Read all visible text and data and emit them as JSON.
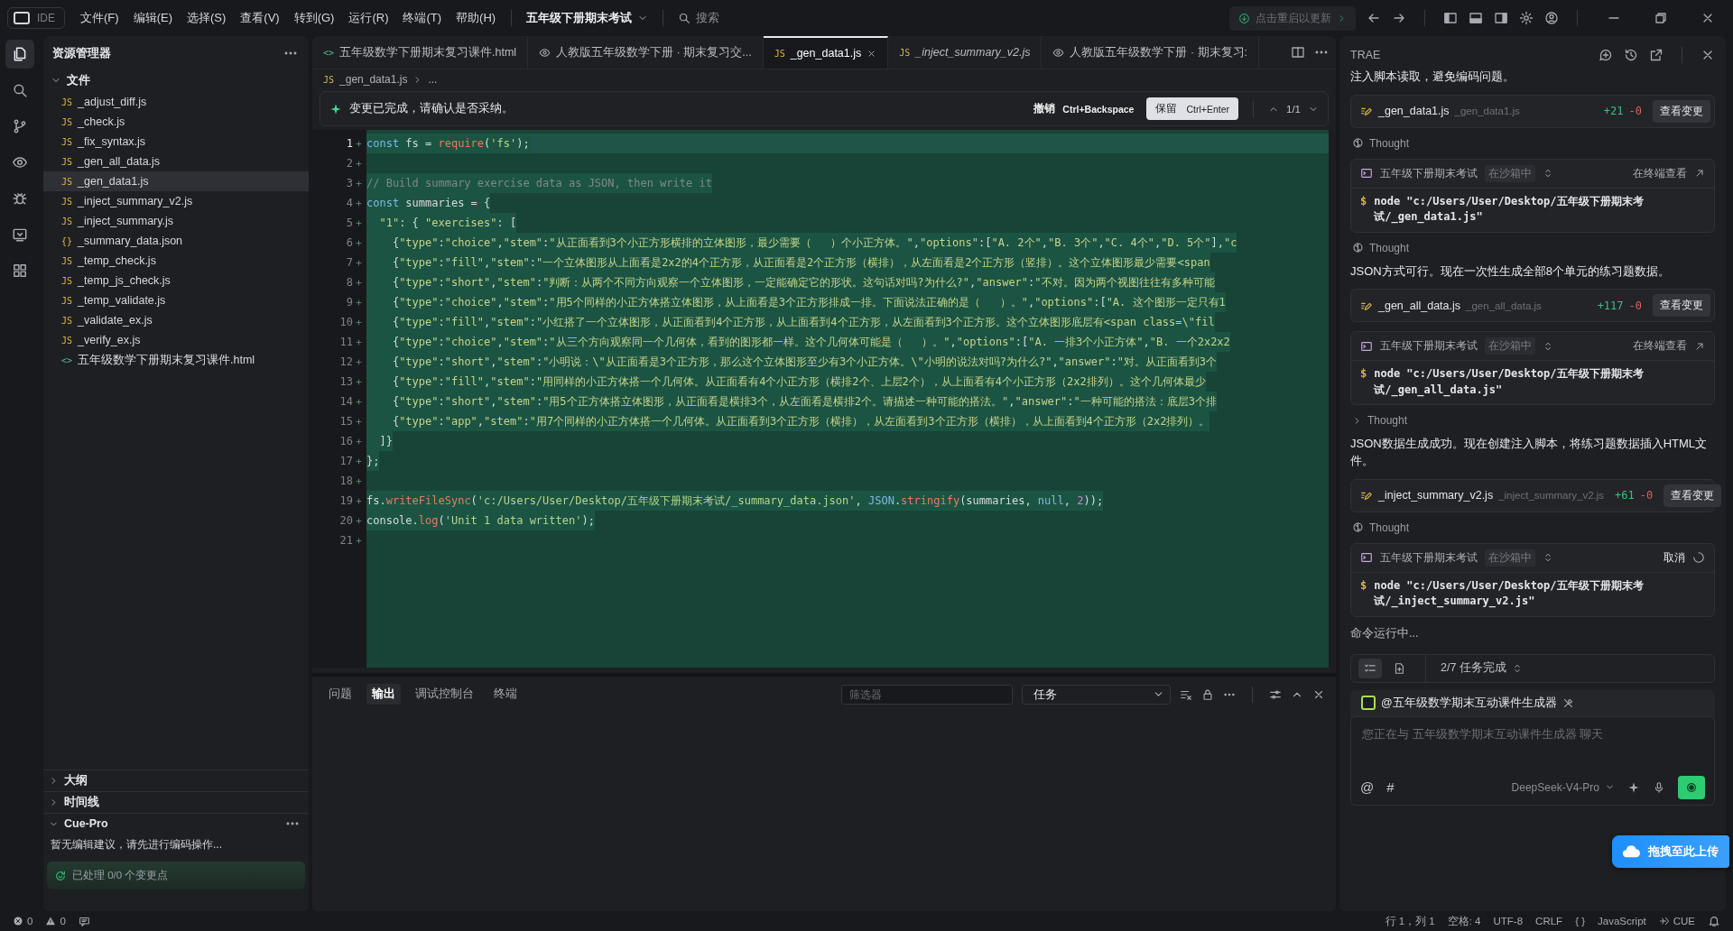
{
  "titlebar": {
    "logo": "IDE",
    "menus": [
      "文件(F)",
      "编辑(E)",
      "选择(S)",
      "查看(V)",
      "转到(G)",
      "运行(R)",
      "终端(T)",
      "帮助(H)"
    ],
    "project": "五年级下册期末考试",
    "search_placeholder": "搜索",
    "update": "点击重启以更新"
  },
  "activity": [
    {
      "kind": "files",
      "selected": true
    },
    {
      "kind": "search",
      "selected": false
    },
    {
      "kind": "branch",
      "selected": false
    },
    {
      "kind": "eye",
      "selected": false
    },
    {
      "kind": "bug",
      "selected": false
    },
    {
      "kind": "remote",
      "selected": false
    },
    {
      "kind": "grid",
      "selected": false
    }
  ],
  "explorer": {
    "title": "资源管理器",
    "folder": "文件",
    "files": [
      {
        "badge": "JS",
        "name": "_adjust_diff.js",
        "selected": false
      },
      {
        "badge": "JS",
        "name": "_check.js",
        "selected": false
      },
      {
        "badge": "JS",
        "name": "_fix_syntax.js",
        "selected": false
      },
      {
        "badge": "JS",
        "name": "_gen_all_data.js",
        "selected": false
      },
      {
        "badge": "JS",
        "name": "_gen_data1.js",
        "selected": true
      },
      {
        "badge": "JS",
        "name": "_inject_summary_v2.js",
        "selected": false
      },
      {
        "badge": "JS",
        "name": "_inject_summary.js",
        "selected": false
      },
      {
        "badge": "{}",
        "name": "_summary_data.json",
        "selected": false
      },
      {
        "badge": "JS",
        "name": "_temp_check.js",
        "selected": false
      },
      {
        "badge": "JS",
        "name": "_temp_js_check.js",
        "selected": false
      },
      {
        "badge": "JS",
        "name": "_temp_validate.js",
        "selected": false
      },
      {
        "badge": "JS",
        "name": "_validate_ex.js",
        "selected": false
      },
      {
        "badge": "JS",
        "name": "_verify_ex.js",
        "selected": false
      },
      {
        "badge": "<>",
        "name": "五年级数学下册期末复习课件.html",
        "selected": false
      }
    ],
    "sections": [
      {
        "title": "大纲",
        "expanded": false
      },
      {
        "title": "时间线",
        "expanded": false
      },
      {
        "title": "Cue-Pro",
        "expanded": true,
        "message": "暂无编辑建议，请先进行编码操作...",
        "status": "已处理 0/0 个变更点"
      }
    ]
  },
  "tabs": [
    {
      "kind": "html",
      "badge": "<>",
      "label": "五年级数学下册期末复习课件.html",
      "selected": false
    },
    {
      "kind": "preview",
      "label": "人教版五年级数学下册 · 期末复习交...",
      "selected": false
    },
    {
      "kind": "js",
      "badge": "JS",
      "label": "_gen_data1.js",
      "selected": true
    },
    {
      "kind": "js",
      "badge": "JS",
      "label": "_inject_summary_v2.js",
      "selected": false
    },
    {
      "kind": "preview",
      "label": "人教版五年级数学下册 · 期末复习:",
      "selected": false
    }
  ],
  "breadcrumb": {
    "badge": "JS",
    "file": "_gen_data1.js",
    "rest": "..."
  },
  "review_bar": {
    "message": "变更已完成，请确认是否采纳。",
    "undo": "撤销",
    "undo_key": "Ctrl+Backspace",
    "keep": "保留",
    "keep_key": "Ctrl+Enter",
    "count": "1/1"
  },
  "code": [
    {
      "num": "1",
      "added": true,
      "text": "const fs = require('fs');"
    },
    {
      "num": "2",
      "added": true
    },
    {
      "num": "3",
      "added": true,
      "text": "// Build summary exercise data as JSON, then write it"
    },
    {
      "num": "4",
      "added": true,
      "text": "const summaries = {"
    },
    {
      "num": "5",
      "added": true,
      "text": "  \"1\": { \"exercises\": ["
    },
    {
      "num": "6",
      "added": true,
      "text": "    {\"type\":\"choice\",\"stem\":\"从正面看到3个小正方形横排的立体图形，最少需要（   ）个小正方体。\",\"options\":[\"A. 2个\",\"B. 3个\",\"C. 4个\",\"D. 5个\"],\"c"
    },
    {
      "num": "7",
      "added": true,
      "text": "    {\"type\":\"fill\",\"stem\":\"一个立体图形从上面看是2x2的4个正方形，从正面看是2个正方形（横排），从左面看是2个正方形（竖排）。这个立体图形最少需要<span"
    },
    {
      "num": "8",
      "added": true,
      "text": "    {\"type\":\"short\",\"stem\":\"判断：从两个不同方向观察一个立体图形，一定能确定它的形状。这句话对吗?为什么?\",\"answer\":\"不对。因为两个视图往往有多种可能"
    },
    {
      "num": "9",
      "added": true,
      "text": "    {\"type\":\"choice\",\"stem\":\"用5个同样的小正方体搭立体图形，从上面看是3个正方形排成一排。下面说法正确的是（   ）。\",\"options\":[\"A. 这个图形一定只有1"
    },
    {
      "num": "10",
      "added": true,
      "text": "    {\"type\":\"fill\",\"stem\":\"小红搭了一个立体图形，从正面看到4个正方形，从上面看到4个正方形，从左面看到3个正方形。这个立体图形底层有<span class=\\\"fil"
    },
    {
      "num": "11",
      "added": true,
      "text": "    {\"type\":\"choice\",\"stem\":\"从三个方向观察同一个几何体，看到的图形都一样。这个几何体可能是（   ）。\",\"options\":[\"A. 一排3个小正方体\",\"B. 一个2x2x2"
    },
    {
      "num": "12",
      "added": true,
      "text": "    {\"type\":\"short\",\"stem\":\"小明说：\\\"从正面看是3个正方形，那么这个立体图形至少有3个小正方体。\\\"小明的说法对吗?为什么?\",\"answer\":\"对。从正面看到3个"
    },
    {
      "num": "13",
      "added": true,
      "text": "    {\"type\":\"fill\",\"stem\":\"用同样的小正方体搭一个几何体。从正面看有4个小正方形（横排2个、上层2个），从上面看有4个小正方形（2x2排列）。这个几何体最少"
    },
    {
      "num": "14",
      "added": true,
      "text": "    {\"type\":\"short\",\"stem\":\"用5个正方体搭立体图形，从正面看是横排3个，从左面看是横排2个。请描述一种可能的搭法。\",\"answer\":\"一种可能的搭法：底层3个排"
    },
    {
      "num": "15",
      "added": true,
      "text": "    {\"type\":\"app\",\"stem\":\"用7个同样的小正方体搭一个几何体。从正面看到3个正方形（横排），从左面看到3个正方形（横排），从上面看到4个正方形（2x2排列）。"
    },
    {
      "num": "16",
      "added": true,
      "text": "  ]}"
    },
    {
      "num": "17",
      "added": true,
      "text": "};"
    },
    {
      "num": "18",
      "added": true
    },
    {
      "num": "19",
      "added": true,
      "text": "fs.writeFileSync('c:/Users/User/Desktop/五年级下册期末考试/_summary_data.json', JSON.stringify(summaries, null, 2));"
    },
    {
      "num": "20",
      "added": true,
      "text": "console.log('Unit 1 data written');"
    },
    {
      "num": "21",
      "added": true
    }
  ],
  "panel": {
    "tabs": [
      {
        "label": "问题",
        "selected": false
      },
      {
        "label": "输出",
        "selected": true
      },
      {
        "label": "调试控制台",
        "selected": false
      },
      {
        "label": "终端",
        "selected": false
      }
    ],
    "filter_placeholder": "筛选器",
    "channel": "任务"
  },
  "assistant": {
    "title": "TRAE",
    "items": [
      {
        "kind": "text",
        "text": "注入脚本读取，避免编码问题。"
      },
      {
        "kind": "file",
        "name": "_gen_data1.js",
        "path": "_gen_data1.js",
        "added": "+21",
        "removed": "-0",
        "button": "查看变更"
      },
      {
        "kind": "thought",
        "label": "Thought",
        "collapsible": false
      },
      {
        "kind": "command",
        "project": "五年级下册期末考试",
        "sandbox": "在沙箱中",
        "action": "在终端查看",
        "running": false,
        "prompt": "$",
        "command": "node \"c:/Users/User/Desktop/五年级下册期末考试/_gen_data1.js\""
      },
      {
        "kind": "thought",
        "label": "Thought",
        "collapsible": false
      },
      {
        "kind": "text",
        "text": "JSON方式可行。现在一次性生成全部8个单元的练习题数据。"
      },
      {
        "kind": "file",
        "name": "_gen_all_data.js",
        "path": "_gen_all_data.js",
        "added": "+117",
        "removed": "-0",
        "button": "查看变更"
      },
      {
        "kind": "command",
        "project": "五年级下册期末考试",
        "sandbox": "在沙箱中",
        "action": "在终端查看",
        "running": false,
        "prompt": "$",
        "command": "node \"c:/Users/User/Desktop/五年级下册期末考试/_gen_all_data.js\""
      },
      {
        "kind": "thought",
        "label": "Thought",
        "collapsible": true
      },
      {
        "kind": "text",
        "text": "JSON数据生成成功。现在创建注入脚本，将练习题数据插入HTML文件。"
      },
      {
        "kind": "file",
        "name": "_inject_summary_v2.js",
        "path": "_inject_summary_v2.js",
        "added": "+61",
        "removed": "-0",
        "button": "查看变更"
      },
      {
        "kind": "thought",
        "label": "Thought",
        "collapsible": false
      },
      {
        "kind": "command",
        "project": "五年级下册期末考试",
        "sandbox": "在沙箱中",
        "action": "取消",
        "running": true,
        "prompt": "$",
        "command": "node \"c:/Users/User/Desktop/五年级下册期末考试/_inject_summary_v2.js\""
      },
      {
        "kind": "status",
        "text": "命令运行中..."
      }
    ],
    "task_views": [
      {
        "kind": "list",
        "selected": true
      },
      {
        "kind": "doc",
        "selected": false
      }
    ],
    "tasks": "2/7 任务完成",
    "agent": "@五年级数学期末互动课件生成器",
    "input_placeholder": "您正在与 五年级数学期末互动课件生成器 聊天",
    "at": "@",
    "hash": "#",
    "model": "DeepSeek-V4-Pro"
  },
  "upload_overlay": {
    "label": "拖拽至此上传"
  },
  "status_bar": {
    "errors": "0",
    "warnings": "0",
    "items": [
      "行 1，列 1",
      "空格: 4",
      "UTF-8",
      "CRLF",
      "{ }",
      "JavaScript"
    ],
    "cue": "CUE"
  }
}
